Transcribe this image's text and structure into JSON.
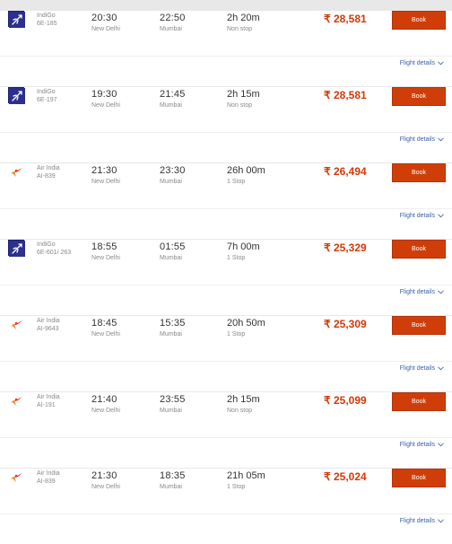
{
  "flights": [
    {
      "airline": "IndiGo",
      "code": "6E-185",
      "dep": "20:30",
      "from": "New Delhi",
      "arr": "22:50",
      "to": "Mumbai",
      "duration": "2h 20m",
      "stops": "Non stop",
      "price": "₹ 28,581",
      "book": "Book",
      "details": "Flight details",
      "logo": "indigo-logo-icon"
    },
    {
      "airline": "IndiGo",
      "code": "6E-197",
      "dep": "19:30",
      "from": "New Delhi",
      "arr": "21:45",
      "to": "Mumbai",
      "duration": "2h 15m",
      "stops": "Non stop",
      "price": "₹ 28,581",
      "book": "Book",
      "details": "Flight details",
      "logo": "indigo-logo-icon"
    },
    {
      "airline": "Air India",
      "code": "AI-839",
      "dep": "21:30",
      "from": "New Delhi",
      "arr": "23:30",
      "to": "Mumbai",
      "duration": "26h 00m",
      "stops": "1 Stop",
      "price": "₹ 26,494",
      "book": "Book",
      "details": "Flight details",
      "logo": "air-india-logo-icon"
    },
    {
      "airline": "IndiGo",
      "code": "6E-601/ 263",
      "dep": "18:55",
      "from": "New Delhi",
      "arr": "01:55",
      "to": "Mumbai",
      "duration": "7h 00m",
      "stops": "1 Stop",
      "price": "₹ 25,329",
      "book": "Book",
      "details": "Flight details",
      "logo": "indigo-logo-icon"
    },
    {
      "airline": "Air India",
      "code": "AI-9643",
      "dep": "18:45",
      "from": "New Delhi",
      "arr": "15:35",
      "to": "Mumbai",
      "duration": "20h 50m",
      "stops": "1 Stop",
      "price": "₹ 25,309",
      "book": "Book",
      "details": "Flight details",
      "logo": "air-india-logo-icon"
    },
    {
      "airline": "Air India",
      "code": "AI-191",
      "dep": "21:40",
      "from": "New Delhi",
      "arr": "23:55",
      "to": "Mumbai",
      "duration": "2h 15m",
      "stops": "Non stop",
      "price": "₹ 25,099",
      "book": "Book",
      "details": "Flight details",
      "logo": "air-india-logo-icon"
    },
    {
      "airline": "Air India",
      "code": "AI-839",
      "dep": "21:30",
      "from": "New Delhi",
      "arr": "18:35",
      "to": "Mumbai",
      "duration": "21h 05m",
      "stops": "1 Stop",
      "price": "₹ 25,024",
      "book": "Book",
      "details": "Flight details",
      "logo": "air-india-logo-icon"
    }
  ],
  "colors": {
    "price": "#d13a08",
    "book_button": "#cf3e09",
    "link": "#3a5fa8",
    "indigo": "#2b2f8f",
    "air_india": "#e03a2a"
  }
}
